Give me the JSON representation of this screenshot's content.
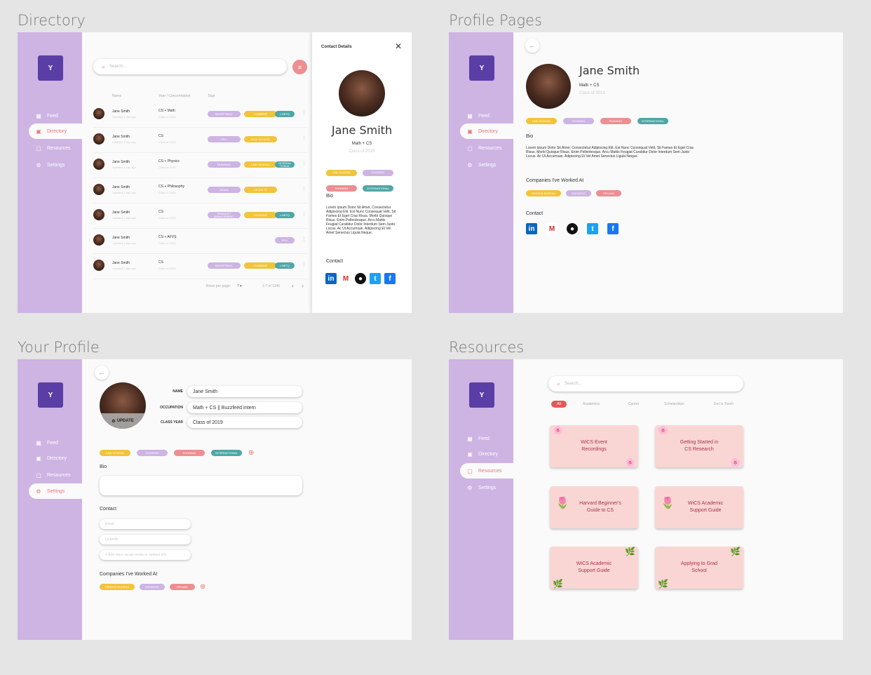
{
  "sections": {
    "directory": "Directory",
    "profile_pages": "Profile Pages",
    "your_profile": "Your Profile",
    "resources": "Resources"
  },
  "logo": "Y",
  "nav": [
    "Feed",
    "Directory",
    "Resources",
    "Settings"
  ],
  "directory": {
    "search_placeholder": "Search...",
    "col_name": "Name",
    "col_year": "Year / Concentration",
    "col_tags": "Tags",
    "rows": [
      {
        "name": "Jane Smith",
        "updated": "Updated 1 day ago",
        "conc": "CS + Math",
        "year": "Class of 2019",
        "tags": [
          "BASKETBALL",
          "CLIMBING",
          "LGBTQ"
        ]
      },
      {
        "name": "Jane Smith",
        "updated": "Updated 1 day ago",
        "conc": "CS",
        "year": "Class of 2019",
        "tags": [
          "PELI",
          "HIGH SCHOOL"
        ]
      },
      {
        "name": "Jane Smith",
        "updated": "Updated 1 day ago",
        "conc": "CS + Physics",
        "year": "Class of 2019",
        "tags": [
          "RUNNING",
          "LAW SCHOOL",
          "INTERNA TIONAL"
        ]
      },
      {
        "name": "Jane Smith",
        "updated": "Updated 1 day ago",
        "conc": "CS + Philosophy",
        "year": "Class of 2019",
        "tags": [
          "ASIAN",
          "CS 124 TF"
        ]
      },
      {
        "name": "Jane Smith",
        "updated": "Updated 1 day ago",
        "conc": "CS",
        "year": "Class of 2019",
        "tags": [
          "PRODUCT MANAGEMENT",
          "COOKING",
          "LGBTQ"
        ]
      },
      {
        "name": "Jane Smith",
        "updated": "Updated 1 day ago",
        "conc": "CS + AFVS",
        "year": "Class of 2019",
        "tags": [
          "PELI"
        ]
      },
      {
        "name": "Jane Smith",
        "updated": "Updated 1 day ago",
        "conc": "CS",
        "year": "Class of 2019",
        "tags": [
          "BASKETBALL",
          "CLIMBING",
          "LGBTQ"
        ]
      }
    ],
    "rows_per_page": "Rows per page:",
    "rows_value": "7",
    "pagination": "1-7 of 1240"
  },
  "contact_panel": {
    "title": "Contact Details",
    "name": "Jane Smith",
    "conc": "Math + CS",
    "year": "Class of 2019",
    "tags": [
      "LAW SCHOOL",
      "COOKING",
      "RUNNING",
      "INTERNATIONAL"
    ],
    "bio_label": "Bio",
    "bio": "Lorem Ipsum Dolor Sit Amet, Consectetur Adipiscing Elit. Est Nunc Consequat Velit, Sit Fames Et Eget Cras Risus. Morbi Quisque Risus. Enim Pellentesque. Arcu Mattis Feugiat Curabitur Dolor Interdum Sem Justo Locus. Ac Ut Accumsan. Adipiscing Et Vel Amet Senectus Ligula Neque.",
    "contact_label": "Contact"
  },
  "profile_page": {
    "name": "Jane Smith",
    "conc": "Math + CS",
    "year": "Class of 2019",
    "tags": [
      "LAW SCHOOL",
      "COOKING",
      "RUNNING",
      "INTERNATIONAL"
    ],
    "bio_label": "Bio",
    "bio": "Lorem Ipsum Dolor Sit Amet, Consectetur Adipiscing Elit. Est Nunc Consequat Velit, Sit Fames Et Eget Cras Risus. Morbi Quisque Risus. Enim Pellentesque. Arcu Mattis Feugiat Curabitur Dolor Interdum Sem Justo Locus. Ac Ut Accumsan. Adipiscing Et Vel Amet Senectus Ligula Neque.",
    "companies_label": "Companies I've Worked At",
    "companies": [
      "CENSUS BUREAU",
      "DATADOG",
      "SPLUNK"
    ],
    "contact_label": "Contact"
  },
  "your_profile": {
    "update": "UPDATE",
    "name_label": "NAME",
    "name": "Jane Smith",
    "occ_label": "OCCUPATION",
    "occ": "Math + CS || Buzzfeed Intern",
    "year_label": "CLASS YEAR",
    "year": "Class of 2019",
    "tags": [
      "LAW SCHOOL",
      "COOKING",
      "RUNNING",
      "INTERNATIONAL"
    ],
    "bio_label": "Bio",
    "contact_label": "Contact",
    "email_ph": "Email",
    "linkedin_ph": "LinkedIn",
    "more_ph": "+ Add more social media or contact info",
    "companies_label": "Companies I've Worked At",
    "companies": [
      "CENSUS BUREAU",
      "DATADOG",
      "SPLUNK"
    ]
  },
  "resources": {
    "search_placeholder": "Search...",
    "tabs": [
      "All",
      "Academics",
      "Career",
      "Scholarships",
      "Get in Touch"
    ],
    "cards": [
      "WiCS Event Recordings",
      "Getting Started in CS Research",
      "Harvard Beginner's Guide to CS",
      "WiCS Academic Support Guide",
      "WiCS Academic Support Guide",
      "Applying to Grad School"
    ]
  },
  "colors": {
    "sidebar": "#cdb4e3",
    "logo": "#5a3ea6",
    "accent": "#e07a7a",
    "card": "#f9d6d4"
  }
}
